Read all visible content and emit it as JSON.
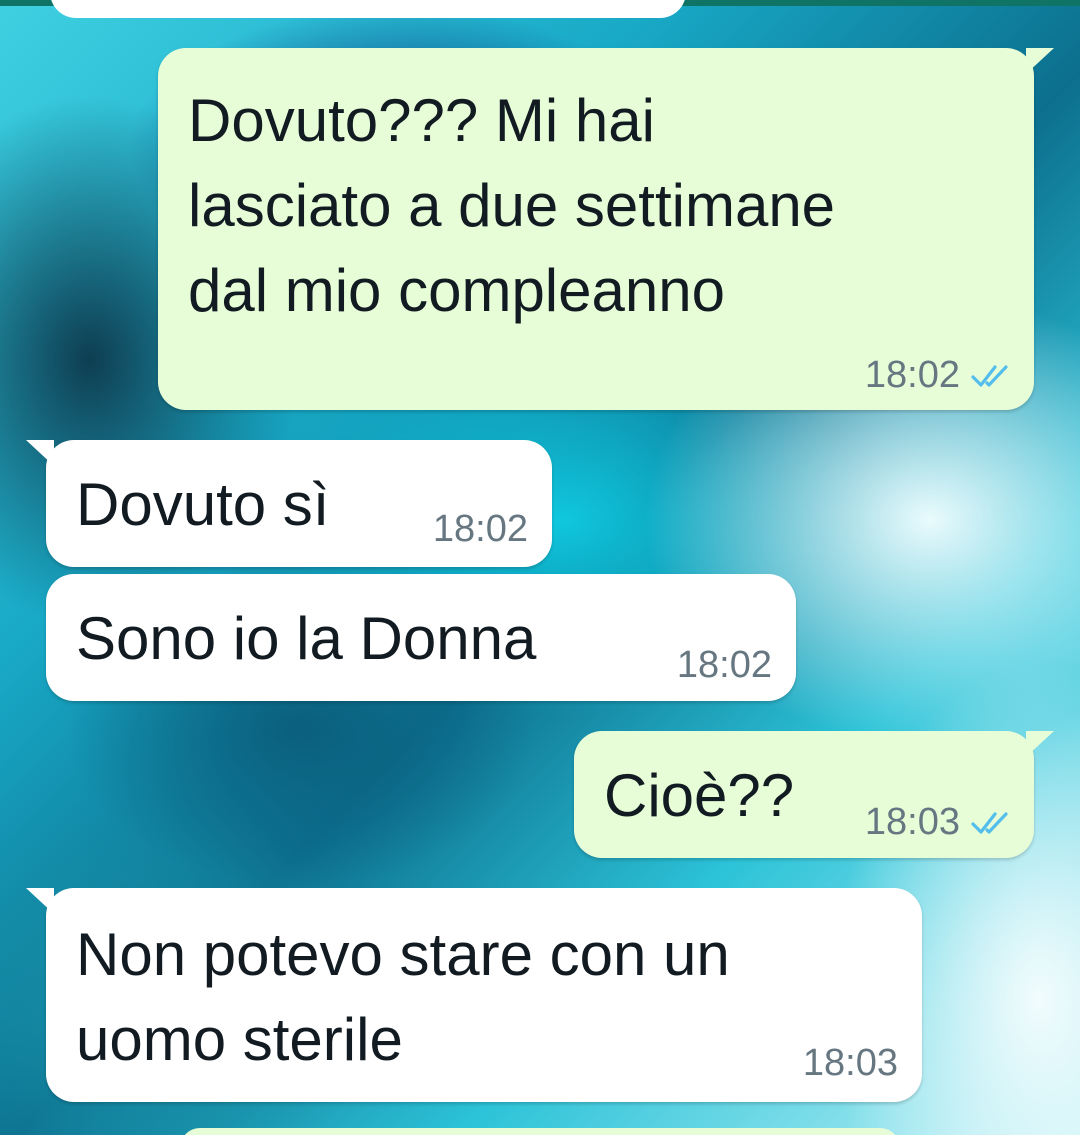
{
  "messages": [
    {
      "direction": "outgoing",
      "text": "Dovuto??? Mi hai\nlasciato a due settimane\ndal mio compleanno",
      "time": "18:02",
      "status": "read"
    },
    {
      "direction": "incoming",
      "text": "Dovuto sì",
      "time": "18:02"
    },
    {
      "direction": "incoming",
      "text": "Sono io la Donna",
      "time": "18:02"
    },
    {
      "direction": "outgoing",
      "text": "Cioè??",
      "time": "18:03",
      "status": "read"
    },
    {
      "direction": "incoming",
      "text": "Non potevo stare con un\nuomo sterile",
      "time": "18:03"
    }
  ],
  "colors": {
    "outgoing_bubble": "#e7fdd8",
    "incoming_bubble": "#ffffff",
    "read_ticks": "#53bdeb",
    "timestamp": "#667781"
  },
  "icons": {
    "read_status": "double-check-icon"
  }
}
